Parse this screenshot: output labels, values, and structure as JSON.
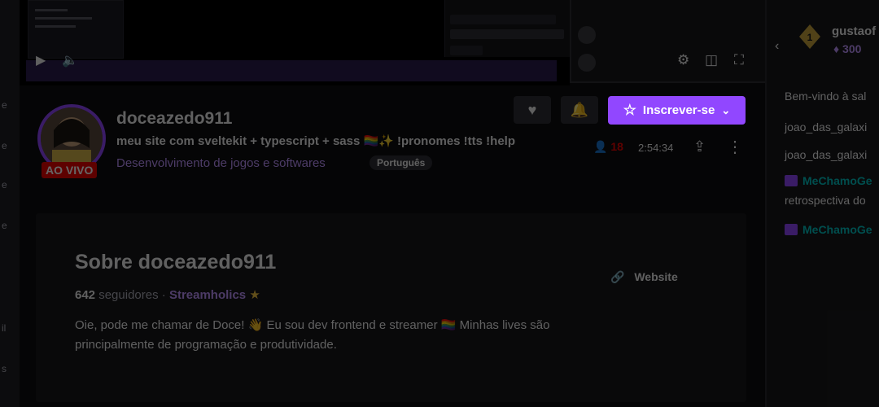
{
  "channel": {
    "name": "doceazedo911",
    "title": "meu site com sveltekit + typescript + sass 🏳️‍🌈✨ !pronomes !tts !help",
    "category": "Desenvolvimento de jogos e softwares",
    "language": "Português",
    "live_label": "AO VIVO",
    "viewers": "18",
    "uptime": "2:54:34"
  },
  "actions": {
    "subscribe_label": "Inscrever-se",
    "follow_icon": "heart-icon",
    "notify_icon": "bell-icon"
  },
  "about": {
    "title": "Sobre doceazedo911",
    "followers_count": "642",
    "followers_label": "seguidores",
    "separator": "·",
    "team": "Streamholics",
    "bio": "Oie, pode me chamar de Doce! 👋 Eu sou dev frontend e streamer 🏳️‍🌈 Minhas lives são principalmente de programação e produtividade.",
    "website_label": "Website"
  },
  "chat": {
    "header_user": "gustaof",
    "header_points": "300",
    "lines": [
      {
        "text": "Bem-vindo à sal"
      },
      {
        "text": "joao_das_galaxi"
      },
      {
        "text": "joao_das_galaxi"
      }
    ],
    "messages": [
      {
        "name": "MeChamoGe",
        "text": "retrospectiva do"
      },
      {
        "name": "MeChamoGe",
        "text": ""
      }
    ]
  },
  "colors": {
    "accent": "#9147ff",
    "live": "#eb0400",
    "background": "#0e0e10"
  }
}
